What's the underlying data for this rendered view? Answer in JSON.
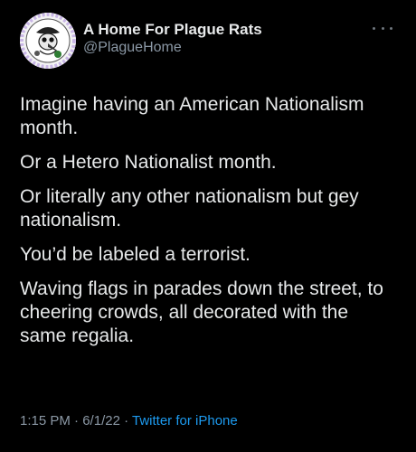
{
  "author": {
    "display_name": "A Home For Plague Rats",
    "handle": "@PlagueHome",
    "avatar_icon": "plague-doctor-rat-icon"
  },
  "more_icon": "ellipsis-icon",
  "tweet": {
    "paragraphs": [
      "Imagine having an American Nationalism month.",
      "Or a Hetero Nationalist month.",
      "Or literally any other nationalism but gey nationalism.",
      "You’d be labeled a terrorist.",
      "Waving flags in parades down the street, to cheering crowds, all decorated with the same regalia."
    ]
  },
  "meta": {
    "time": "1:15 PM",
    "separator": " · ",
    "date": "6/1/22",
    "separator2": " · ",
    "source": "Twitter for iPhone"
  },
  "colors": {
    "background": "#000000",
    "text": "#e7e9ea",
    "secondary": "#8b98a5",
    "link": "#1d9bf0"
  }
}
